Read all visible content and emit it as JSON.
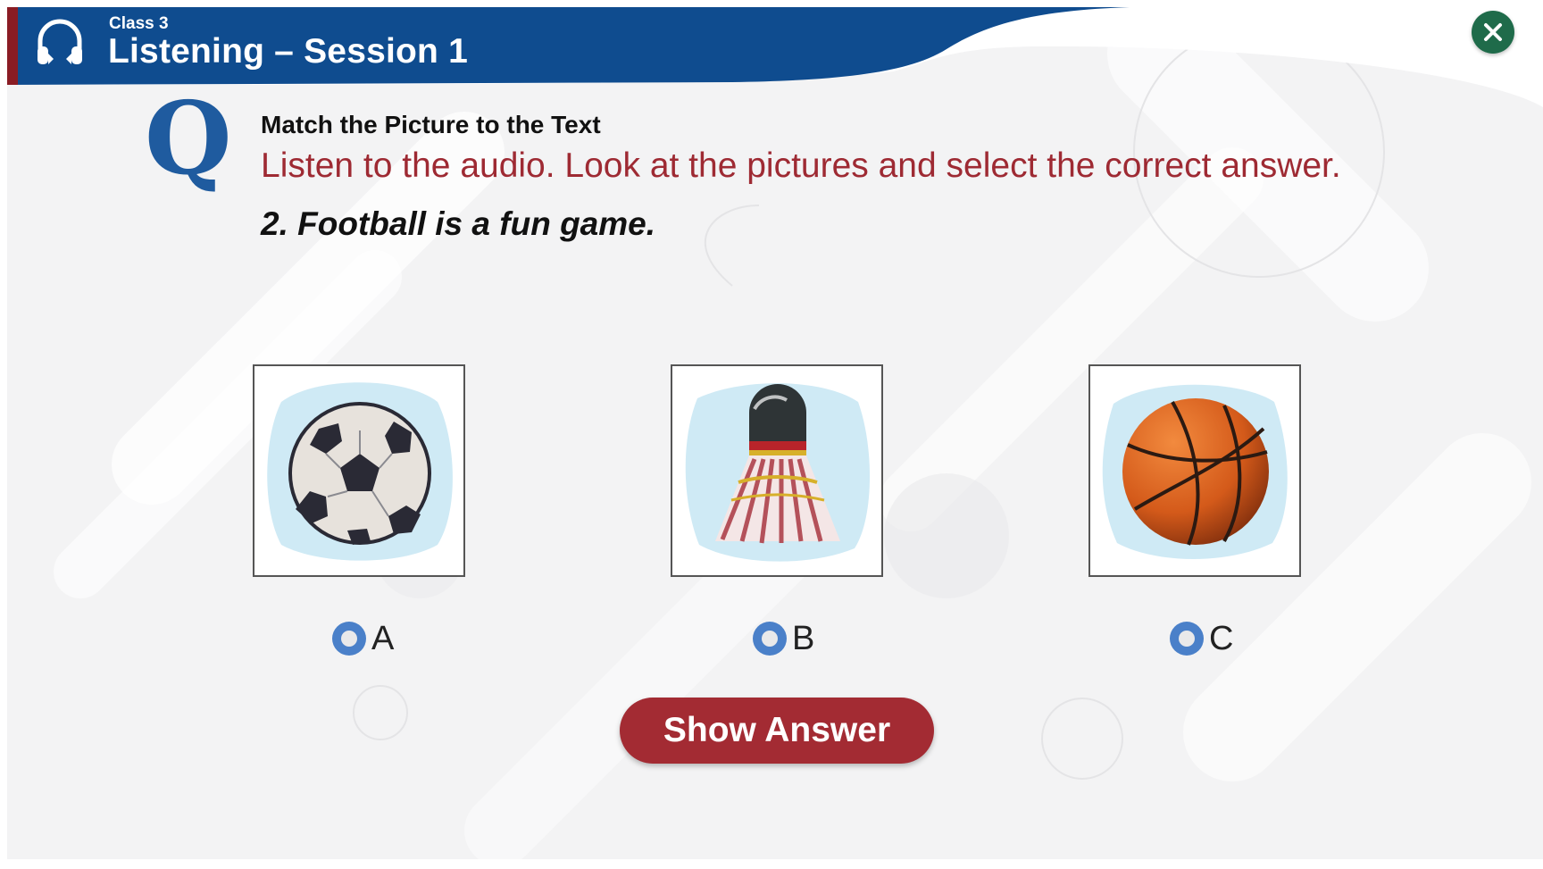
{
  "header": {
    "class_label": "Class 3",
    "title": "Listening – Session 1",
    "icon": "headphones-icon",
    "close_icon": "close-icon"
  },
  "question": {
    "letter": "Q",
    "heading": "Match the Picture to the Text",
    "instruction": "Listen to the audio. Look at the pictures and select the correct answer.",
    "sentence": "2. Football is a fun game."
  },
  "options": [
    {
      "label": "A",
      "image": "soccer-ball-icon"
    },
    {
      "label": "B",
      "image": "shuttlecock-icon"
    },
    {
      "label": "C",
      "image": "basketball-icon"
    }
  ],
  "show_answer_label": "Show Answer",
  "colors": {
    "header_blue": "#0f4c8f",
    "accent_red": "#a32b33",
    "close_green": "#1f6b4a",
    "q_blue": "#1f5b9f",
    "radio_blue": "#4a80c9"
  }
}
